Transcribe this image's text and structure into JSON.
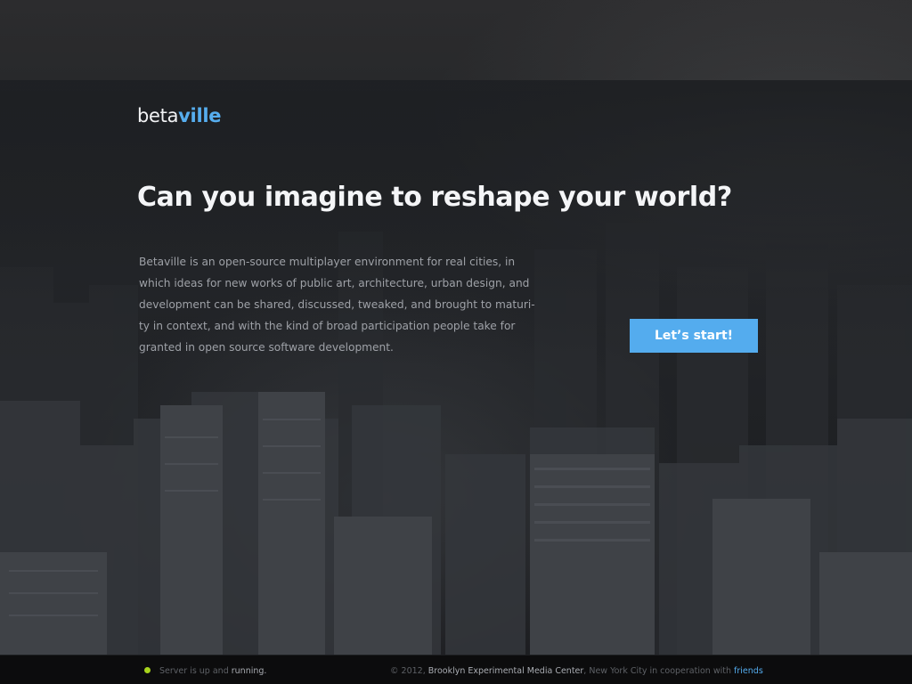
{
  "brand": {
    "logo_part1": "beta",
    "logo_part2": "ville",
    "accent_color": "#54acee"
  },
  "hero": {
    "headline": "Can you imagine to reshape your world?",
    "description_lines": [
      "Betaville is an open-source multiplayer environment for real cities, in",
      "which ideas for new works of public art, architecture, urban design, and",
      "development can be shared, discussed, tweaked, and brought to maturi-",
      "ty in context, and with the kind of broad participation people take for",
      "granted in open source software development."
    ],
    "cta_label": "Let’s start!"
  },
  "footer": {
    "status_prefix": "Server is up and ",
    "status_value": "running.",
    "status_color": "#a8d41c",
    "copyright_prefix": "© 2012, ",
    "organization": "Brooklyn Experimental Media Center",
    "location_text": ", New York City in cooperation with ",
    "friends_link": "friends"
  },
  "background": {
    "icon": "city-skyline-photo"
  }
}
